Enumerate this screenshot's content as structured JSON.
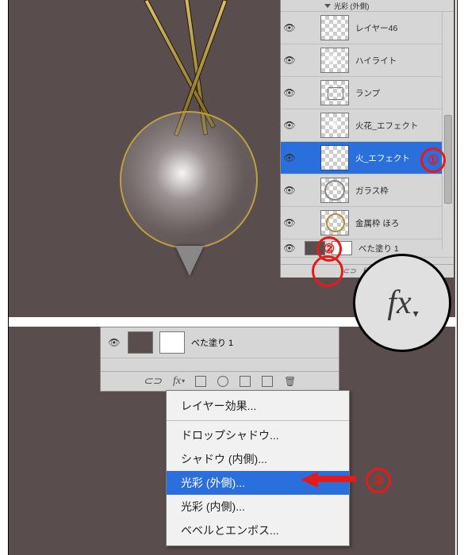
{
  "panel": {
    "effect_header": "光彩 (外側)",
    "layers": [
      {
        "name": "レイヤー46"
      },
      {
        "name": "ハイライト"
      },
      {
        "name": "ランプ"
      },
      {
        "name": "火花_エフェクト"
      },
      {
        "name": "火_エフェクト"
      },
      {
        "name": "ガラス枠"
      },
      {
        "name": "金属枠 ほろ"
      },
      {
        "name": "べた塗り 1"
      }
    ],
    "footer_icons": {
      "link": "⊂⊃",
      "fx": "fx",
      "mask": "◻",
      "fill": "◯",
      "folder": "▣",
      "new": "▤",
      "trash": "🗑"
    }
  },
  "fx_zoom_label": "fx",
  "bottom_panel": {
    "layer_name": "べた塗り 1"
  },
  "menu": {
    "items": [
      {
        "label": "レイヤー効果...",
        "selected": false
      },
      {
        "label": "ドロップシャドウ...",
        "selected": false
      },
      {
        "label": "シャドウ (内側)...",
        "selected": false
      },
      {
        "label": "光彩 (外側)...",
        "selected": true
      },
      {
        "label": "光彩 (内側)...",
        "selected": false
      },
      {
        "label": "ベベルとエンボス...",
        "selected": false
      }
    ]
  },
  "annotations": {
    "one": "①",
    "two": "②",
    "three": "③"
  }
}
